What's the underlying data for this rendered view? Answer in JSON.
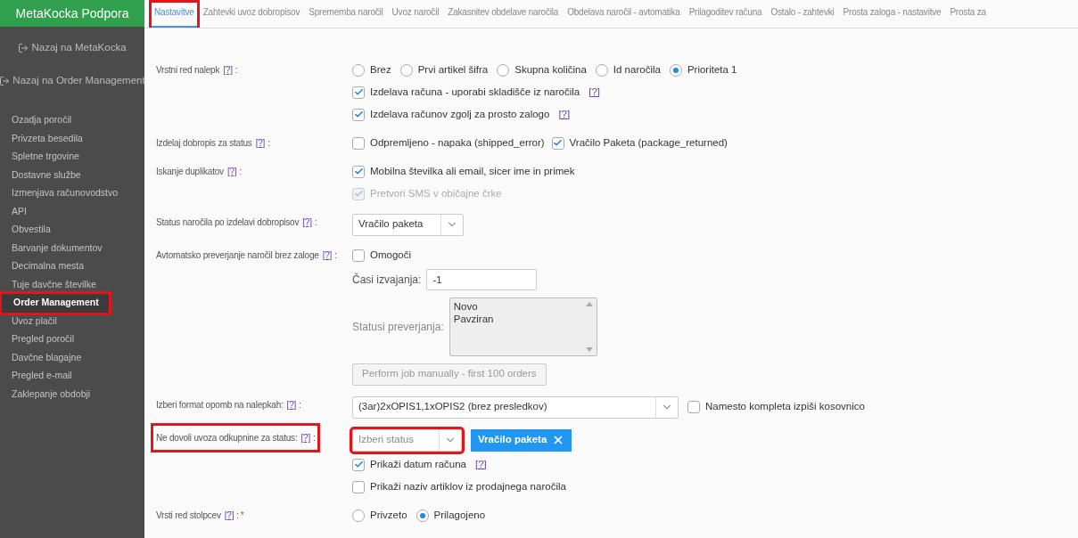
{
  "sidebar": {
    "title": "MetaKocka Podpora",
    "links": [
      {
        "label": "Nazaj na MetaKocka"
      },
      {
        "label": "Nazaj na Order Management"
      }
    ],
    "items": [
      {
        "label": "Ozadja poročil",
        "selected": false,
        "highlighted": false
      },
      {
        "label": "Privzeta besedila",
        "selected": false,
        "highlighted": false
      },
      {
        "label": "Spletne trgovine",
        "selected": false,
        "highlighted": false
      },
      {
        "label": "Dostavne službe",
        "selected": false,
        "highlighted": false
      },
      {
        "label": "Izmenjava računovodstvo",
        "selected": false,
        "highlighted": false
      },
      {
        "label": "API",
        "selected": false,
        "highlighted": false
      },
      {
        "label": "Obvestila",
        "selected": false,
        "highlighted": false
      },
      {
        "label": "Barvanje dokumentov",
        "selected": false,
        "highlighted": false
      },
      {
        "label": "Decimalna mesta",
        "selected": false,
        "highlighted": false
      },
      {
        "label": "Tuje davčne številke",
        "selected": false,
        "highlighted": false
      },
      {
        "label": "Order Management",
        "selected": true,
        "highlighted": true
      },
      {
        "label": "Uvoz plačil",
        "selected": false,
        "highlighted": false
      },
      {
        "label": "Pregled poročil",
        "selected": false,
        "highlighted": false
      },
      {
        "label": "Davčne blagajne",
        "selected": false,
        "highlighted": false
      },
      {
        "label": "Pregled e-mail",
        "selected": false,
        "highlighted": false
      },
      {
        "label": "Zaklepanje obdobji",
        "selected": false,
        "highlighted": false
      }
    ]
  },
  "tabs": [
    {
      "label": "Nastavitve",
      "selected": true,
      "highlighted": true
    },
    {
      "label": "Zahtevki uvoz dobropisov",
      "selected": false,
      "highlighted": false
    },
    {
      "label": "Sprememba naročil",
      "selected": false,
      "highlighted": false
    },
    {
      "label": "Uvoz naročil",
      "selected": false,
      "highlighted": false
    },
    {
      "label": "Zakasnitev obdelave naročila",
      "selected": false,
      "highlighted": false
    },
    {
      "label": "Obdelava naročil - avtomatika",
      "selected": false,
      "highlighted": false
    },
    {
      "label": "Prilagoditev računa",
      "selected": false,
      "highlighted": false
    },
    {
      "label": "Ostalo - zahtevki",
      "selected": false,
      "highlighted": false
    },
    {
      "label": "Prosta zaloga - nastavitve",
      "selected": false,
      "highlighted": false
    },
    {
      "label": "Prosta za",
      "selected": false,
      "highlighted": false
    }
  ],
  "rows": [
    {
      "label": "Vrstni red nalepk",
      "help": "[?]",
      "colon": ":",
      "highlighted": false,
      "lines": [
        [
          {
            "kind": "radio",
            "label": "Brez",
            "selected": false
          },
          {
            "kind": "radio",
            "label": "Prvi artikel šifra",
            "selected": false
          },
          {
            "kind": "radio",
            "label": "Skupna količina",
            "selected": false
          },
          {
            "kind": "radio",
            "label": "Id naročila",
            "selected": false
          },
          {
            "kind": "radio",
            "label": "Prioriteta 1",
            "selected": true
          }
        ],
        [
          {
            "kind": "checkbox",
            "label": "Izdelava računa - uporabi skladišče iz naročila",
            "help": "[?]",
            "checked": true,
            "disabled": false
          }
        ],
        [
          {
            "kind": "checkbox",
            "label": "Izdelava računov zgolj za prosto zalogo",
            "help": "[?]",
            "checked": true,
            "disabled": false
          }
        ]
      ]
    },
    {
      "label": "Izdelaj dobropis za status",
      "help": "[?]",
      "colon": ":",
      "highlighted": false,
      "lines": [
        [
          {
            "kind": "checkbox",
            "label": "Odpremljeno - napaka (shipped_error)",
            "checked": false,
            "disabled": false
          },
          {
            "kind": "checkbox",
            "label": "Vračilo Paketa (package_returned)",
            "checked": true,
            "disabled": false
          }
        ]
      ]
    },
    {
      "label": "Iskanje duplikatov",
      "help": "[?]",
      "colon": ":",
      "highlighted": false,
      "lines": [
        [
          {
            "kind": "checkbox",
            "label": "Mobilna številka ali email, sicer ime in primek",
            "checked": true,
            "disabled": false
          }
        ],
        [
          {
            "kind": "checkbox",
            "label": "Pretvori SMS v običajne črke",
            "checked": true,
            "disabled": true
          }
        ]
      ]
    },
    {
      "label": "Status naročila po izdelavi dobropisov",
      "help": "[?]",
      "colon": ":",
      "highlighted": false,
      "lines": [
        [
          {
            "kind": "select",
            "value": "Vračilo paketa",
            "placeholder": false,
            "highlighted": false
          }
        ]
      ]
    },
    {
      "label": "Avtomatsko preverjanje naročil brez zaloge",
      "help": "[?]",
      "colon": ":",
      "highlighted": false,
      "lines": [
        [
          {
            "kind": "checkbox",
            "label": "Omogoči",
            "checked": false,
            "disabled": false
          }
        ],
        [
          {
            "kind": "text_input",
            "label": "Časi izvajanja:",
            "value": "-1"
          }
        ],
        [
          {
            "kind": "listbox",
            "label": "Statusi preverjanja:",
            "options": [
              "Novo",
              "Pavziran"
            ]
          }
        ],
        [
          {
            "kind": "button",
            "label": "Perform job manually - first 100 orders"
          }
        ]
      ]
    },
    {
      "label": "Izberi format opomb na nalepkah:",
      "help": "[?]",
      "colon": ":",
      "highlighted": false,
      "lines": [
        [
          {
            "kind": "wide_select",
            "value": "(3ar)2xOPIS1,1xOPIS2 (brez presledkov)",
            "placeholder": false,
            "highlighted": false
          },
          {
            "kind": "checkbox",
            "label": "Namesto kompleta izpiši kosovnico",
            "checked": false,
            "disabled": false
          }
        ]
      ]
    },
    {
      "label": "Ne dovoli uvoza odkupnine za status:",
      "help": "[?]",
      "colon": ":",
      "highlighted": true,
      "lines": [
        [
          {
            "kind": "select",
            "value": "Izberi status",
            "placeholder": true,
            "highlighted": true
          },
          {
            "kind": "tag",
            "label": "Vračilo paketa"
          }
        ],
        [
          {
            "kind": "checkbox",
            "label": "Prikaži datum računa",
            "help": "[?]",
            "checked": true,
            "disabled": false
          }
        ],
        [
          {
            "kind": "checkbox",
            "label": "Prikaži naziv artiklov iz prodajnega naročila",
            "checked": false,
            "disabled": false
          }
        ]
      ]
    },
    {
      "label": "Vrsti red stolpcev",
      "help": "[?]",
      "colon": ":",
      "required": "*",
      "highlighted": false,
      "lines": [
        [
          {
            "kind": "radio",
            "label": "Privzeto",
            "selected": false
          },
          {
            "kind": "radio",
            "label": "Prilagojeno",
            "selected": true
          }
        ]
      ]
    }
  ]
}
